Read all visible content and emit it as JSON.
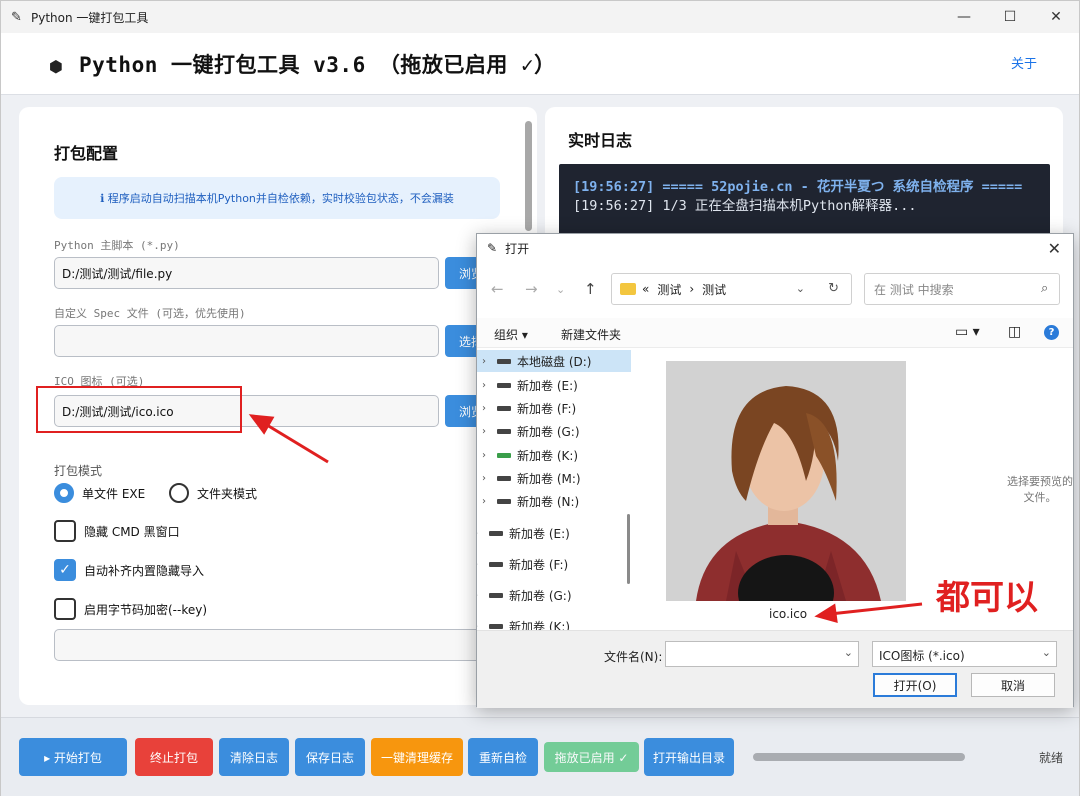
{
  "window": {
    "title": "Python 一键打包工具"
  },
  "header": {
    "title": "Python 一键打包工具 v3.6  （拖放已启用 ✓）",
    "about": "关于"
  },
  "config": {
    "section_title": "打包配置",
    "info": "ℹ 程序启动自动扫描本机Python并自检依赖，实时校验包状态，不会漏装",
    "script_label": "Python 主脚本 (*.py)",
    "script_value": "D:/测试/测试/file.py",
    "script_browse": "浏览",
    "spec_label": "自定义 Spec 文件 (可选，优先使用)",
    "spec_value": "",
    "spec_browse": "选择",
    "ico_label": "ICO 图标 (可选)",
    "ico_value": "D:/测试/测试/ico.ico",
    "ico_browse": "浏览",
    "mode_label": "打包模式",
    "mode_single": "单文件 EXE",
    "mode_folder": "文件夹模式",
    "opt_hide_cmd": "隐藏 CMD 黑窗口",
    "opt_auto_import": "自动补齐内置隐藏导入",
    "opt_encrypt": "启用字节码加密(--key)"
  },
  "log": {
    "title": "实时日志",
    "line1": "[19:56:27] ===== 52pojie.cn - 花开半夏つ 系统自检程序 =====",
    "line2": "[19:56:27] 1/3 正在全盘扫描本机Python解释器..."
  },
  "bottom": {
    "buttons": [
      {
        "label": "▸ 开始打包",
        "color": "#3b8ddd"
      },
      {
        "label": "终止打包",
        "color": "#e8413a"
      },
      {
        "label": "清除日志",
        "color": "#3b8ddd"
      },
      {
        "label": "保存日志",
        "color": "#3b8ddd"
      },
      {
        "label": "一键清理缓存",
        "color": "#f7960e"
      },
      {
        "label": "重新自检",
        "color": "#3b8ddd"
      },
      {
        "label": "拖放已启用 ✓",
        "color": "#4cc27a"
      },
      {
        "label": "打开输出目录",
        "color": "#3b8ddd"
      }
    ],
    "status": "就绪",
    "progress": 0
  },
  "dialog": {
    "title": "打开",
    "path": [
      "«",
      "测试",
      "›",
      "测试"
    ],
    "search_placeholder": "在 测试 中搜索",
    "organize": "组织 ▾",
    "new_folder": "新建文件夹",
    "tree": [
      "本地磁盘 (D:)",
      "新加卷 (E:)",
      "新加卷 (F:)",
      "新加卷 (G:)",
      "新加卷 (K:)",
      "新加卷 (M:)",
      "新加卷 (N:)",
      "新加卷 (E:)",
      "新加卷 (F:)",
      "新加卷 (G:)",
      "新加卷 (K:)"
    ],
    "file_name": "ico.ico",
    "preview_hint": "选择要预览的文件。",
    "filename_label": "文件名(N):",
    "filetype": "ICO图标 (*.ico)",
    "open_btn": "打开(O)",
    "cancel_btn": "取消"
  },
  "annotation": {
    "text": "都可以",
    "color": "#e02020"
  }
}
